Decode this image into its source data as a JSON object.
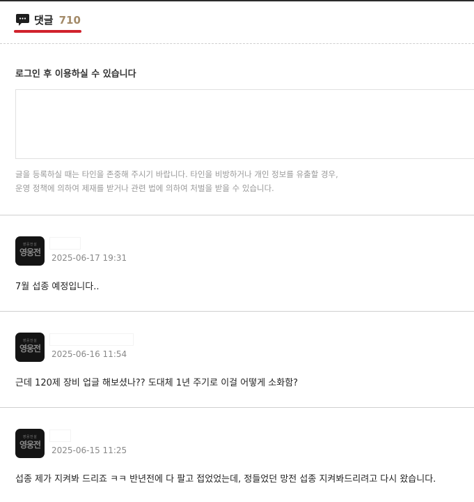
{
  "header": {
    "icon": "speech-bubble-icon",
    "title": "댓글",
    "count": "710"
  },
  "login_notice": "로그인 후 이용하실 수 있습니다",
  "comment_input": {
    "placeholder": ""
  },
  "policy": {
    "line1": "글을 등록하실 때는 타인을 존중해 주시기 바랍니다. 타인을 비방하거나 개인 정보를 유출할 경우,",
    "line2": "운영 정책에 의하여 제재를 받거나 관련 법에 의하여 처벌을 받을 수 있습니다."
  },
  "avatar": {
    "subtitle": "영웅전설",
    "title": "영웅전"
  },
  "comments": [
    {
      "timestamp": "2025-06-17 19:31",
      "text": "7월 섭종 예정입니다.."
    },
    {
      "timestamp": "2025-06-16 11:54",
      "text": "근데 120제 장비 업글 해보셨나?? 도대체 1년 주기로 이걸 어떻게 소화함?"
    },
    {
      "timestamp": "2025-06-15 11:25",
      "text": "섭종 제가 지켜봐 드리죠 ㅋㅋ 반년전에 다 팔고 접었었는데, 정들었던 망전 섭종 지켜봐드리려고 다시 왔습니다."
    }
  ],
  "colors": {
    "accent_underline": "#d1222d",
    "count": "#a38a68"
  }
}
